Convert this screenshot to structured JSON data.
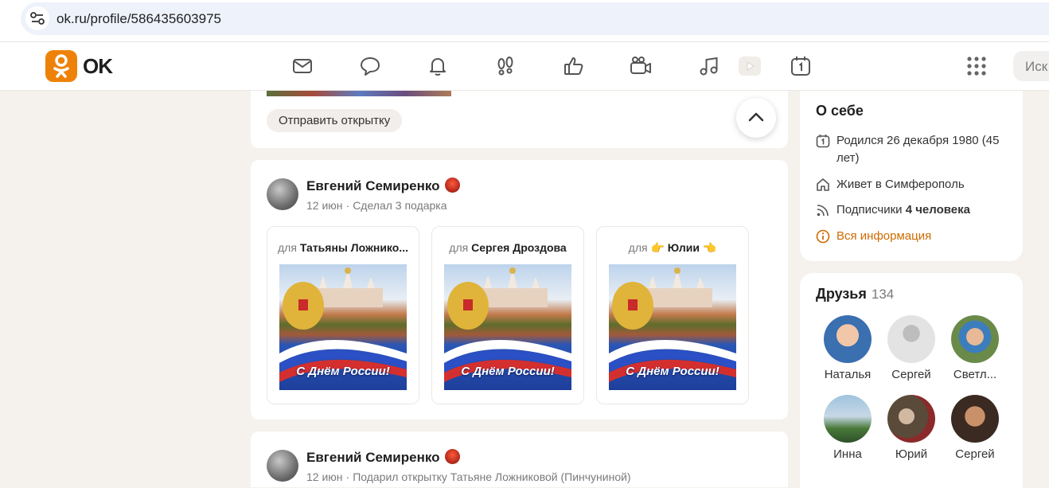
{
  "browser": {
    "url": "ok.ru/profile/586435603975"
  },
  "header": {
    "logo_text": "OK",
    "search_placeholder": "Иск",
    "accent": "#ee8208"
  },
  "nav_icons": [
    "mail-icon",
    "chat-icon",
    "bell-icon",
    "footprints-icon",
    "like-icon",
    "video-camera-icon",
    "music-icon",
    "video-play-icon",
    "calendar-icon"
  ],
  "feed": {
    "card1": {
      "send_card_button": "Отправить открытку"
    },
    "post1": {
      "author": "Евгений Семиренко",
      "date": "12 июн",
      "separator": "·",
      "action": "Сделал 3 подарка",
      "gifts": [
        {
          "for_prefix": "для",
          "recipient": "Татьяны Ложнико...",
          "caption": "С Днём России!"
        },
        {
          "for_prefix": "для",
          "recipient": "Сергея Дроздова",
          "caption": "С Днём России!"
        },
        {
          "for_prefix": "для",
          "recipient": "👉 Юлии 👈",
          "caption": "С Днём России!"
        }
      ]
    },
    "post2": {
      "author": "Евгений Семиренко",
      "date": "12 июн",
      "separator": "·",
      "action": "Подарил открытку Татьяне Ложниковой (Пинчуниной)"
    }
  },
  "about": {
    "title": "О себе",
    "born": "Родился 26 декабря 1980 (45 лет)",
    "lives": "Живет в Симферополь",
    "subscribers_label": "Подписчики",
    "subscribers_value": "4 человека",
    "all_info": "Вся информация"
  },
  "friends": {
    "title": "Друзья",
    "count": "134",
    "items": [
      {
        "name": "Наталья",
        "color": "#3a6fb0"
      },
      {
        "name": "Сергей",
        "color": "#d9d9d9"
      },
      {
        "name": "Светл...",
        "color": "#6a8a4a"
      },
      {
        "name": "Инна",
        "color": "#4f7f9f"
      },
      {
        "name": "Юрий",
        "color": "#7a4a3a"
      },
      {
        "name": "Сергей",
        "color": "#5a3a2a"
      }
    ]
  }
}
